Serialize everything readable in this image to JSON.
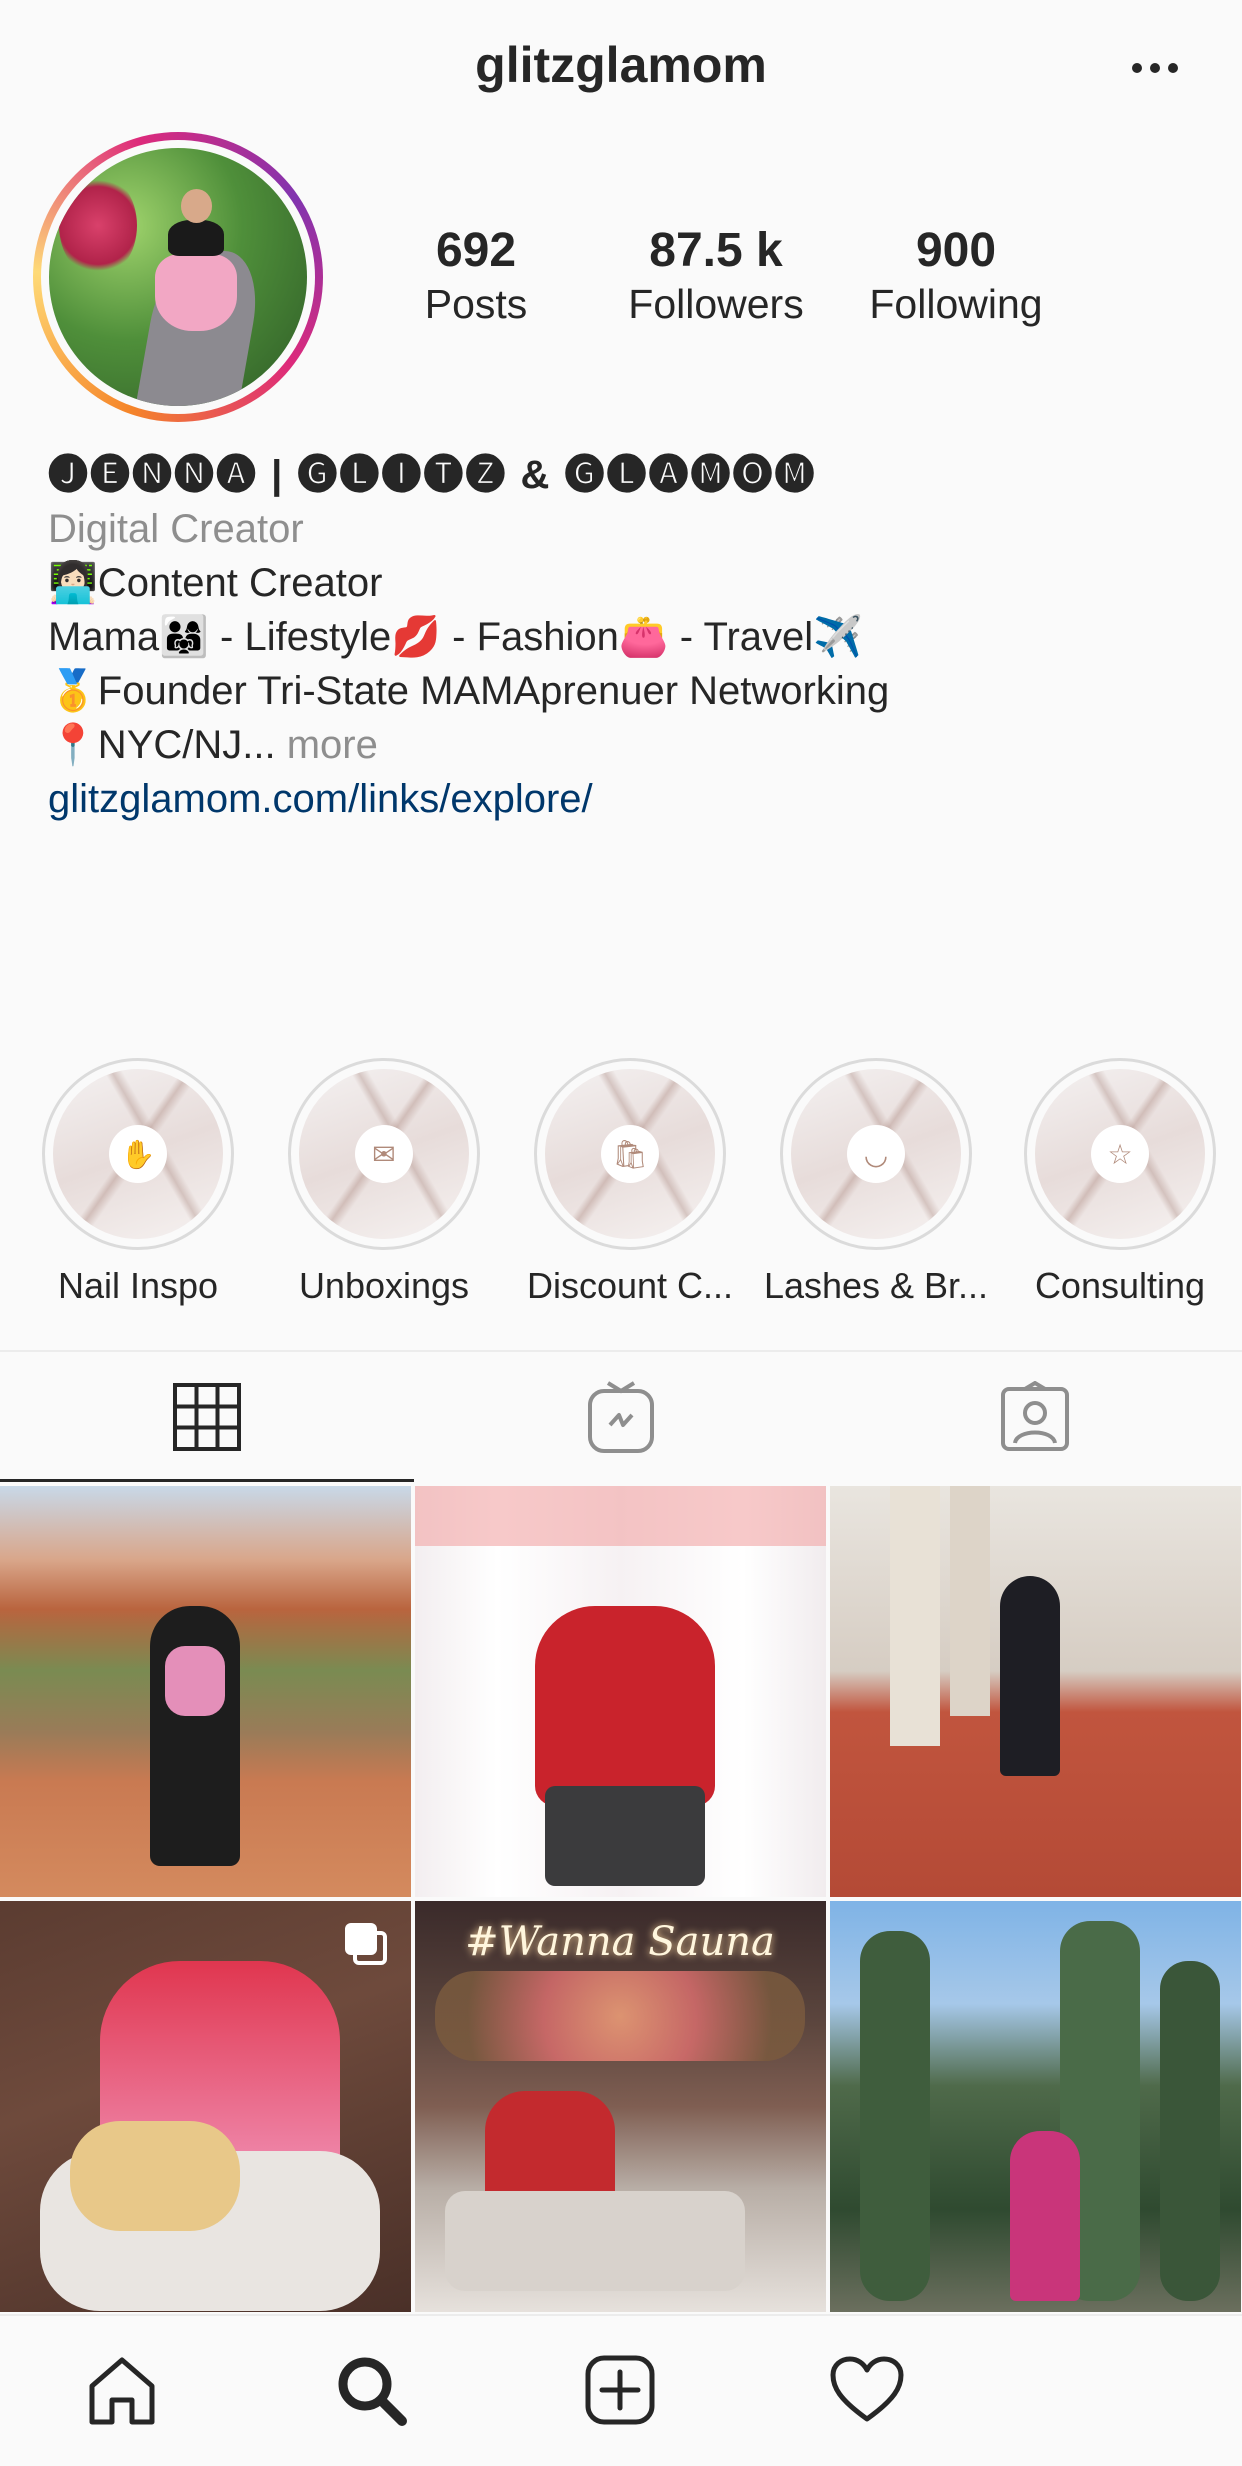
{
  "header": {
    "username": "glitzglamom",
    "more_icon": "more-horizontal-icon"
  },
  "profile": {
    "avatar": "profile-photo",
    "stats": [
      {
        "value": "692",
        "label": "Posts"
      },
      {
        "value": "87.5 k",
        "label": "Followers"
      },
      {
        "value": "900",
        "label": "Following"
      }
    ]
  },
  "bio": {
    "name": "🅙🅔🅝🅝🅐 | 🅖🅛🅘🅣🅩 & 🅖🅛🅐🅜🅞🅜",
    "category": "Digital Creator",
    "line1": "👩🏻‍💻Content Creator",
    "line2": "Mama👨‍👩‍👧 - Lifestyle💋 - Fashion👛 - Travel✈️",
    "line3": "🥇Founder Tri-State MAMAprenuer Networking",
    "line4_text": "📍NYC/NJ...",
    "line4_more": "more",
    "link": "glitzglamom.com/links/explore/"
  },
  "highlights": [
    {
      "label": "Nail Inspo",
      "icon": "nail-icon",
      "glyph": "✋"
    },
    {
      "label": "Unboxings",
      "icon": "envelope-icon",
      "glyph": "✉"
    },
    {
      "label": "Discount C...",
      "icon": "shopping-bag-icon",
      "glyph": "🛍"
    },
    {
      "label": "Lashes & Br...",
      "icon": "eye-lash-icon",
      "glyph": "◡"
    },
    {
      "label": "Consulting",
      "icon": "star-icon",
      "glyph": "☆"
    }
  ],
  "tabs": [
    {
      "name": "grid",
      "icon": "grid-icon",
      "active": true
    },
    {
      "name": "igtv",
      "icon": "igtv-icon",
      "active": false
    },
    {
      "name": "tagged",
      "icon": "tagged-icon",
      "active": false
    }
  ],
  "posts": [
    {
      "scene": "red-rock-canyon"
    },
    {
      "scene": "valentine-love-backdrop"
    },
    {
      "scene": "colonnade-walkway"
    },
    {
      "scene": "puppy-on-couch",
      "multi": true
    },
    {
      "scene": "wanna-sauna-neon",
      "neon_text": "#Wanna Sauna"
    },
    {
      "scene": "cactus-garden"
    }
  ],
  "bottom_nav": [
    {
      "name": "home",
      "icon": "home-icon"
    },
    {
      "name": "search",
      "icon": "search-icon"
    },
    {
      "name": "new-post",
      "icon": "add-post-icon"
    },
    {
      "name": "activity",
      "icon": "heart-icon"
    }
  ]
}
